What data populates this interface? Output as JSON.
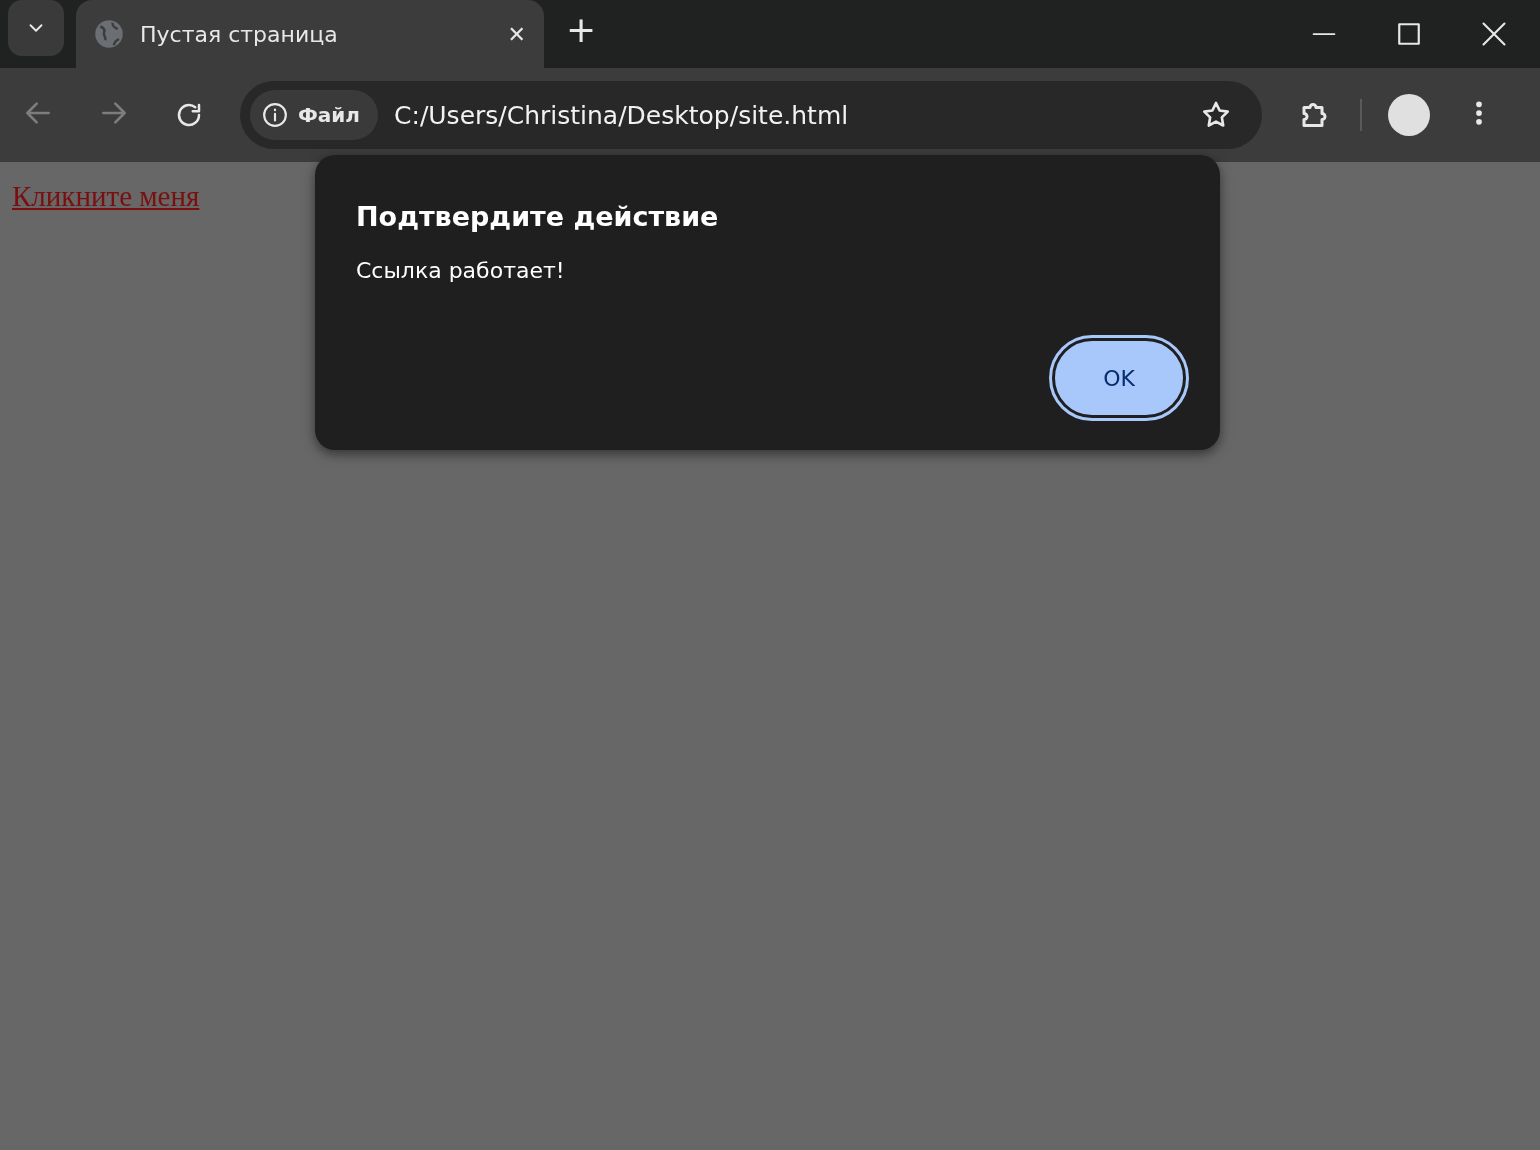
{
  "tabs": [
    {
      "title": "Пустая страница",
      "selected": true,
      "close": "✕"
    }
  ],
  "new_tab": "+",
  "toolbar": {
    "back_disabled": true,
    "forward_disabled": true,
    "site_info": "Файл",
    "address": "C:/Users/Christina/Desktop/site.html"
  },
  "page": {
    "link": "Кликните меня"
  },
  "dialog": {
    "title": "Подтвердите действие",
    "message": "Ссылка работает!",
    "buttons": [
      {
        "label": "OK",
        "focused": true
      }
    ]
  }
}
